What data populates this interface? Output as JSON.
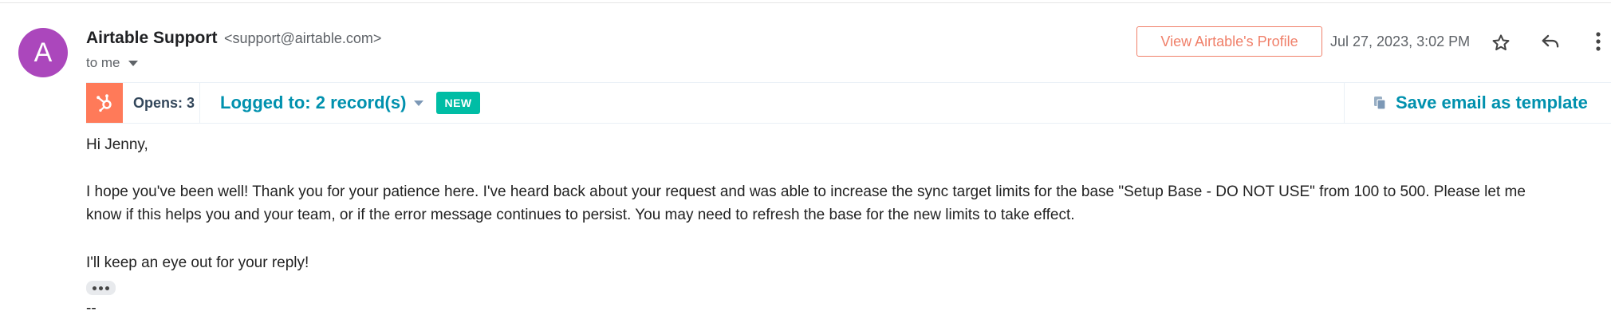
{
  "sender": {
    "avatar_letter": "A",
    "avatar_color": "#ab47bc",
    "name": "Airtable Support",
    "email": "<support@airtable.com>",
    "recipient_label": "to me"
  },
  "header_actions": {
    "profile_button_label": "View Airtable's Profile",
    "date": "Jul 27, 2023, 3:02 PM",
    "icons": [
      "star-icon",
      "reply-icon",
      "more-vert-icon"
    ]
  },
  "hubspot": {
    "logo_icon": "hubspot-sprocket-icon",
    "brand_color": "#ff7a59",
    "opens_label": "Opens: 3",
    "logged_label": "Logged to: 2 record(s)",
    "new_badge": "NEW",
    "save_template_label": "Save email as template",
    "accent_color": "#0091ae"
  },
  "message": {
    "greeting": "Hi Jenny,",
    "paragraph1_line1": "I hope you've been well! Thank you for your patience here. I've heard back about your request and was able to increase the sync target limits for the base \"Setup Base - DO NOT USE\" from 100 to 500. Please let me",
    "paragraph1_line2": "know if this helps you and your team, or if the error message continues to persist. You may need to refresh the base for the new limits to take effect.",
    "closing": "I'll keep an eye out for your reply!",
    "signature_dash": "--"
  }
}
